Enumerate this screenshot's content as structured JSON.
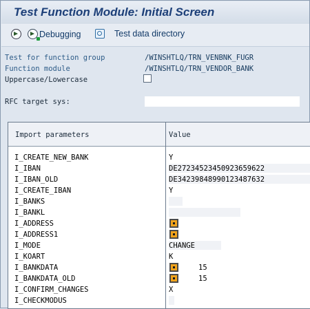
{
  "window": {
    "title": "Test Function Module: Initial Screen"
  },
  "toolbar": {
    "execute_icon": "execute-icon",
    "debugging_icon": "debug-icon",
    "debugging_label": "Debugging",
    "testdata_icon": "test-data-icon",
    "testdata_label": "Test data directory"
  },
  "form": {
    "group_label": "Test for function group",
    "group_value": "/WINSHTLQ/TRN_VENBNK_FUGR",
    "module_label": "Function module",
    "module_value": "/WINSHTLQ/TRN_VENDOR_BANK",
    "case_label": "Uppercase/Lowercase",
    "case_checked": false,
    "rfc_label": "RFC target sys:",
    "rfc_value": ""
  },
  "params": {
    "col_name": "Import parameters",
    "col_value": "Value",
    "rows": [
      {
        "name": "I_CREATE_NEW_BANK",
        "value": "Y",
        "kind": "text"
      },
      {
        "name": "I_IBAN",
        "value": "DE27234523450923659622",
        "kind": "field"
      },
      {
        "name": "I_IBAN_OLD",
        "value": "DE34239848990123487632",
        "kind": "field"
      },
      {
        "name": "I_CREATE_IBAN",
        "value": "Y",
        "kind": "text"
      },
      {
        "name": "I_BANKS",
        "value": "",
        "kind": "field"
      },
      {
        "name": "I_BANKL",
        "value": "",
        "kind": "field"
      },
      {
        "name": "I_ADDRESS",
        "value": "",
        "kind": "object"
      },
      {
        "name": "I_ADDRESS1",
        "value": "",
        "kind": "object"
      },
      {
        "name": "I_MODE",
        "value": "CHANGE",
        "kind": "field"
      },
      {
        "name": "I_KOART",
        "value": "K",
        "kind": "text"
      },
      {
        "name": "I_BANKDATA",
        "value": "15",
        "kind": "object"
      },
      {
        "name": "I_BANKDATA_OLD",
        "value": "15",
        "kind": "object"
      },
      {
        "name": "I_CONFIRM_CHANGES",
        "value": "X",
        "kind": "text"
      },
      {
        "name": "I_CHECKMODUS",
        "value": "",
        "kind": "text"
      }
    ]
  },
  "colors": {
    "title": "#1c3f78",
    "label": "#2e5c88",
    "header_bg": "#eef1f6"
  }
}
